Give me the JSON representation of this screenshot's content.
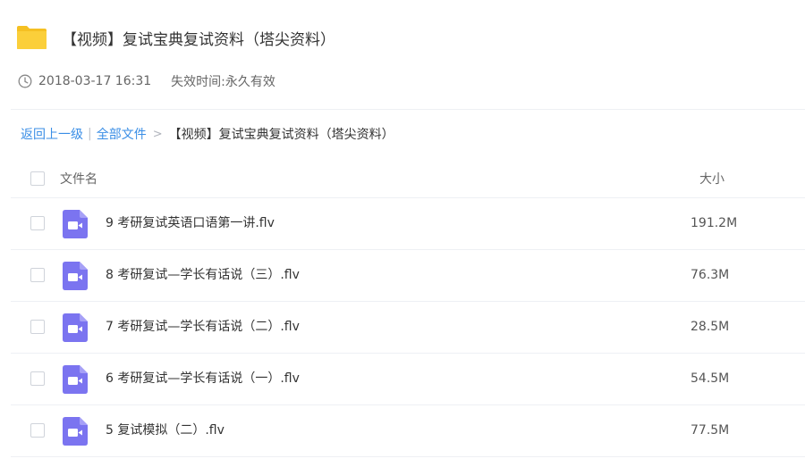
{
  "share": {
    "title": "【视频】复试宝典复试资料（塔尖资料）",
    "date": "2018-03-17 16:31",
    "expire_label": "失效时间:",
    "expire_value": "永久有效",
    "folder_icon": "folder-icon",
    "clock_icon": "clock-icon",
    "folder_color": "#f5c022"
  },
  "breadcrumb": {
    "back": "返回上一级",
    "separator": "|",
    "all_files": "全部文件",
    "arrow": ">",
    "current": "【视频】复试宝典复试资料（塔尖资料）",
    "link_color": "#3a8ee6"
  },
  "table": {
    "col_name": "文件名",
    "col_size": "大小",
    "icon_color": "#7b74f0",
    "rows": [
      {
        "name": "9 考研复试英语口语第一讲.flv",
        "size": "191.2M",
        "icon": "video-file-icon"
      },
      {
        "name": "8 考研复试—学长有话说（三）.flv",
        "size": "76.3M",
        "icon": "video-file-icon"
      },
      {
        "name": "7 考研复试—学长有话说（二）.flv",
        "size": "28.5M",
        "icon": "video-file-icon"
      },
      {
        "name": "6 考研复试—学长有话说（一）.flv",
        "size": "54.5M",
        "icon": "video-file-icon"
      },
      {
        "name": "5 复试模拟（二）.flv",
        "size": "77.5M",
        "icon": "video-file-icon"
      }
    ]
  }
}
